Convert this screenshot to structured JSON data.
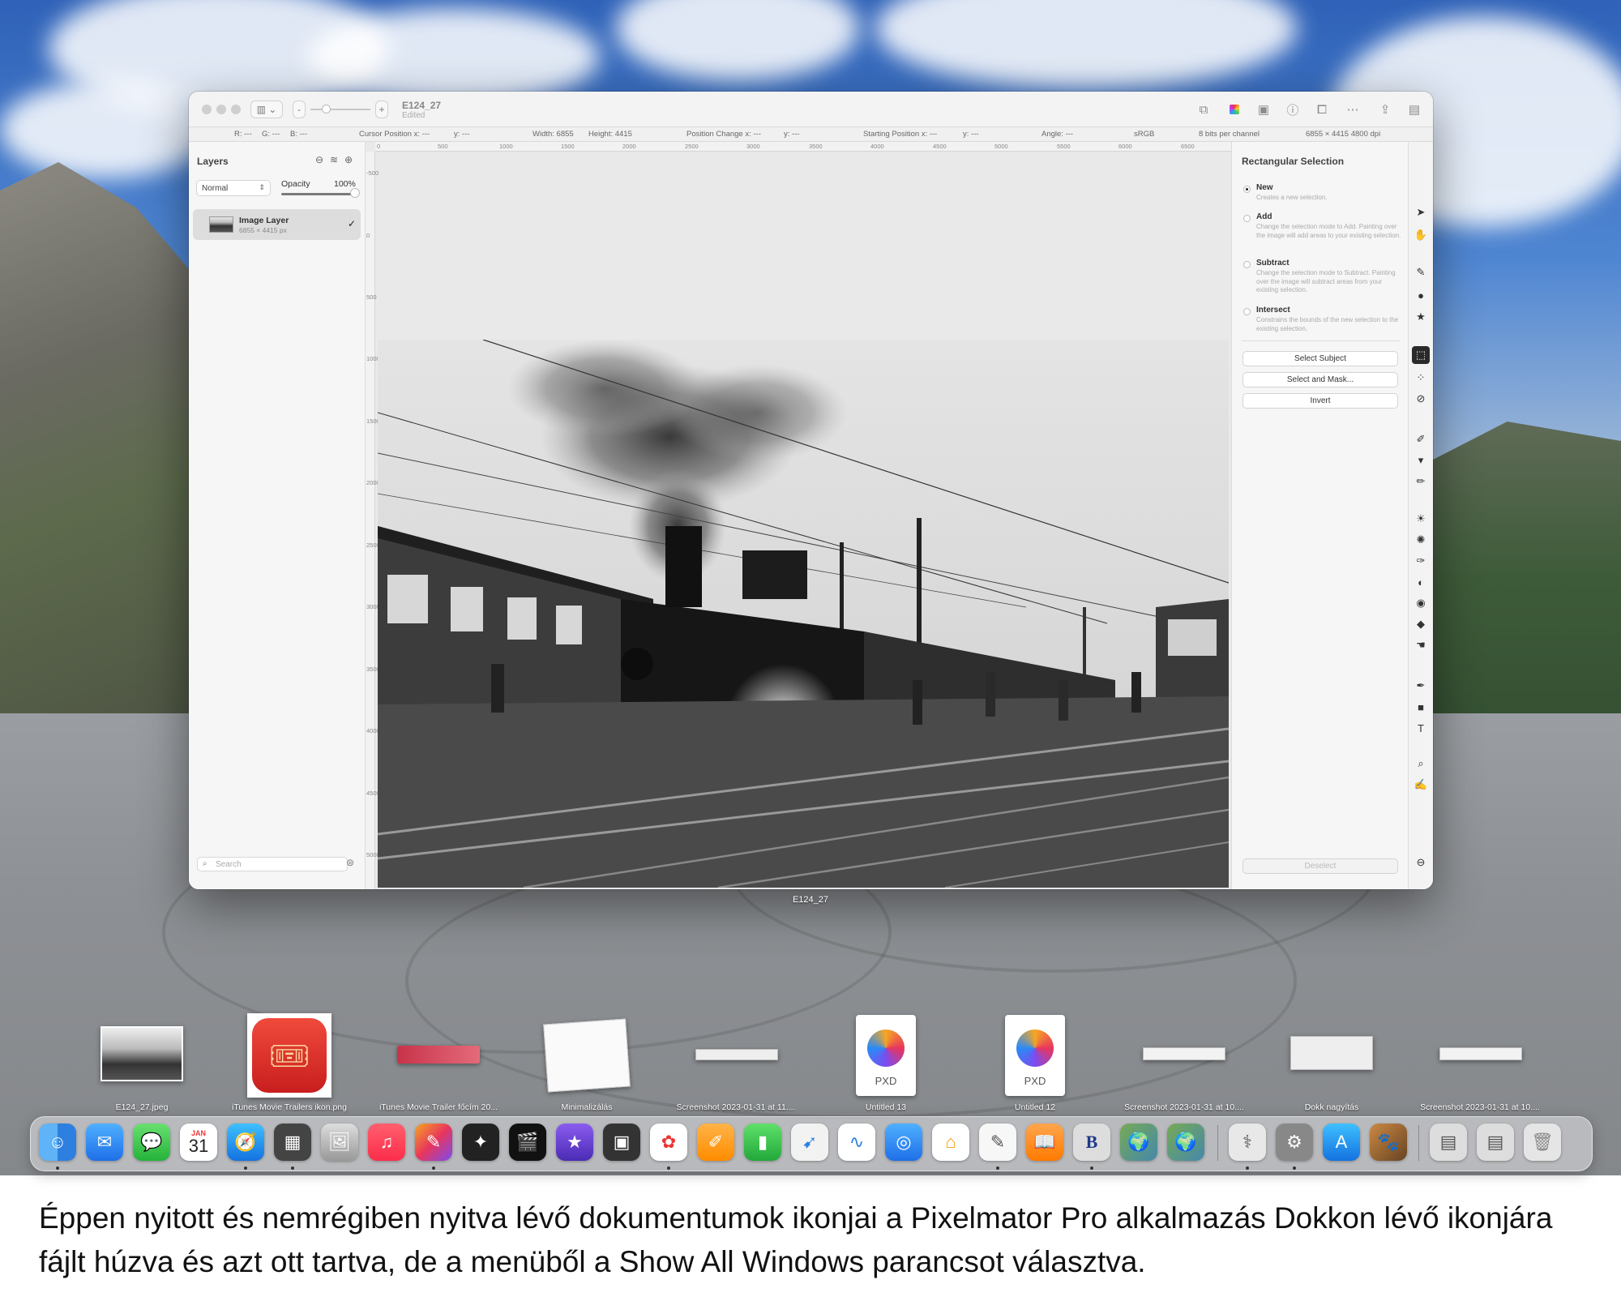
{
  "window": {
    "doc_title": "E124_27",
    "doc_status": "Edited",
    "zoom_minus": "-",
    "zoom_plus": "+",
    "window_label": "E124_27"
  },
  "infobar": {
    "r": "R: ---",
    "g": "G: ---",
    "b": "B: ---",
    "cursor": "Cursor Position x: ---",
    "cursor_y": "y: ---",
    "width": "Width: 6855",
    "height": "Height: 4415",
    "pos_change": "Position Change x: ---",
    "pos_change_y": "y: ---",
    "start_pos": "Starting Position x: ---",
    "start_pos_y": "y: ---",
    "angle": "Angle: ---",
    "color_space": "sRGB",
    "bits": "8 bits per channel",
    "dims": "6855 × 4415 4800 dpi"
  },
  "layers": {
    "title": "Layers",
    "blend_mode": "Normal",
    "opacity_label": "Opacity",
    "opacity_value": "100%",
    "opacity_fraction": 1.0,
    "layer_name": "Image Layer",
    "layer_size": "6855 × 4415 px",
    "search_placeholder": "Search"
  },
  "rulers": {
    "top": [
      "0",
      "500",
      "1000",
      "1500",
      "2000",
      "2500",
      "3000",
      "3500",
      "4000",
      "4500",
      "5000",
      "5500",
      "6000",
      "6500"
    ],
    "left": [
      "-500",
      "0",
      "500",
      "1000",
      "1500",
      "2000",
      "2500",
      "3000",
      "3500",
      "4000",
      "4500",
      "5000"
    ]
  },
  "inspector": {
    "title": "Rectangular Selection",
    "options": [
      {
        "title": "New",
        "desc": "Creates a new selection.",
        "selected": true
      },
      {
        "title": "Add",
        "desc": "Change the selection mode to Add. Painting over the image will add areas to your existing selection.",
        "selected": false
      },
      {
        "title": "Subtract",
        "desc": "Change the selection mode to Subtract. Painting over the image will subtract areas from your existing selection.",
        "selected": false
      },
      {
        "title": "Intersect",
        "desc": "Constrains the bounds of the new selection to the existing selection.",
        "selected": false
      }
    ],
    "btn_select_subject": "Select Subject",
    "btn_select_mask": "Select and Mask...",
    "btn_invert": "Invert",
    "btn_deselect": "Deselect"
  },
  "thumbnails": [
    {
      "label": "E124_27.jpeg"
    },
    {
      "label": "iTunes Movie Trailers ikon.png"
    },
    {
      "label": "iTunes Movie Trailer főcím 20..."
    },
    {
      "label": "Minimalizálás"
    },
    {
      "label": "Screenshot 2023-01-31 at 11...."
    },
    {
      "label": "Untitled 13"
    },
    {
      "label": "Untitled 12"
    },
    {
      "label": "Screenshot 2023-01-31 at 10...."
    },
    {
      "label": "Dokk nagyítás"
    },
    {
      "label": "Screenshot 2023-01-31 at 10...."
    }
  ],
  "pxd_badge": "PXD",
  "calendar": {
    "month": "JAN",
    "day": "31"
  },
  "caption": "Éppen nyitott és nemrégiben nyitva lévő dokumentumok ikonjai a Pixelmator Pro alkalmazás Dokkon lévő ikonjára fájlt húzva és azt ott tartva, de a menüből a Show All Windows parancsot választva."
}
